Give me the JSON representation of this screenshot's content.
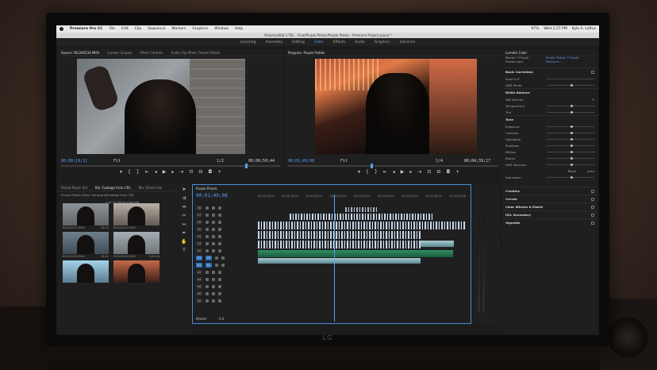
{
  "menubar": {
    "app": "Premiere Pro CC",
    "items": [
      "File",
      "Edit",
      "Clip",
      "Sequence",
      "Markers",
      "Graphics",
      "Window",
      "Help"
    ],
    "battery": "97%",
    "clock": "Wed 2:27 PM",
    "user": "Kyle A. Loftus"
  },
  "window_title": "/Volumes/Kal-1 TB/... Final/Purple Pistols/Purple Pistols - Premiere Project.prproj *",
  "workspaces": {
    "items": [
      "Learning",
      "Assembly",
      "Editing",
      "Color",
      "Effects",
      "Audio",
      "Graphics",
      "Libraries"
    ],
    "active": "Color"
  },
  "source_panel": {
    "tabs": [
      "Source: RG3A0534.MOV",
      "Lumetri Scopes",
      "Effect Controls",
      "Audio Clip Mixer: Purple Pistols"
    ],
    "timecode_in": "00;00;19;11",
    "fit": "Fit",
    "timecode_out": "00;00;50;44",
    "page": "1/2"
  },
  "program_panel": {
    "tab": "Program: Purple Pistols",
    "timecode_in": "00;01;49;08",
    "fit": "Fit",
    "page": "1/4",
    "timecode_out": "00;04;39;17"
  },
  "project_panel": {
    "tabs": [
      "Pistols Music Vid",
      "Bin: Footage from CRL",
      "Bin: Drone Foo"
    ],
    "path": "Purple Pistols Music Vid.prproj/Footage from CRL",
    "count": "1 of 15 items selected",
    "thumbs": [
      {
        "name": "RG3A0225.MOV",
        "dur": "19;22"
      },
      {
        "name": "RG3A0222.MOV",
        "dur": ""
      },
      {
        "name": "RG3A0226.MOV",
        "dur": "49;04"
      },
      {
        "name": "RG3A0224.MOV",
        "dur": "5;04;44"
      },
      {
        "name": "",
        "dur": ""
      },
      {
        "name": "",
        "dur": ""
      }
    ]
  },
  "timeline": {
    "tab": "Purple Pistols",
    "timecode": "00;01;49;08",
    "ruler": [
      "00;01;04;02",
      "00;01;16;02",
      "00;01;28;02",
      "00;01;40;04",
      "00;01;52;04",
      "00;02;04;04",
      "00;02;16;04",
      "00;02;28;04",
      "00;02;40;06"
    ],
    "tracks": [
      {
        "v": "V8",
        "a": ""
      },
      {
        "v": "V7",
        "a": ""
      },
      {
        "v": "V6",
        "a": ""
      },
      {
        "v": "V5",
        "a": ""
      },
      {
        "v": "V4",
        "a": ""
      },
      {
        "v": "V3",
        "a": ""
      },
      {
        "v": "V2",
        "a": ""
      },
      {
        "v": "V1",
        "a": "V1"
      },
      {
        "v": "A1",
        "a": "A1"
      },
      {
        "v": "A2",
        "a": ""
      },
      {
        "v": "A3",
        "a": ""
      },
      {
        "v": "A4",
        "a": ""
      },
      {
        "v": "A5",
        "a": ""
      },
      {
        "v": "A6",
        "a": ""
      }
    ],
    "master_label": "Master",
    "master_value": "0.0"
  },
  "lumetri": {
    "tab": "Lumetri Color",
    "clip": "Master * Purple Pistols.mp4",
    "clip2": "Purple Pistols * Purple Pistols.m...",
    "sections": [
      {
        "title": "Basic Correction",
        "rows": [
          "Input LUT",
          "HDR White"
        ]
      },
      {
        "title": "White Balance",
        "rows": [
          "WB Selector",
          "Temperature",
          "Tint"
        ]
      },
      {
        "title": "Tone",
        "rows": [
          "Exposure",
          "Contrast",
          "Highlights",
          "Shadows",
          "Whites",
          "Blacks",
          "HDR Specular"
        ]
      },
      {
        "title": "",
        "rows": [
          "Saturation"
        ]
      }
    ],
    "collapsed": [
      "Creative",
      "Curves",
      "Color Wheels & Match",
      "HSL Secondary",
      "Vignette"
    ],
    "reset": "Reset",
    "auto": "Auto"
  },
  "monitor_brand": "LG",
  "colors": {
    "accent": "#5aa0f5",
    "panel": "#1f1f20",
    "audio_clip": "#2f8f63"
  }
}
